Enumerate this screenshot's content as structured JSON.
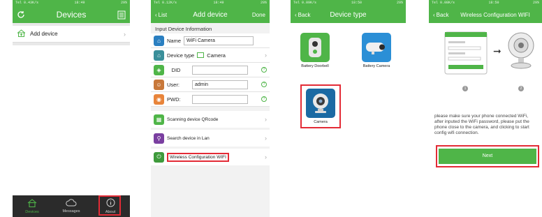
{
  "colors": {
    "accent": "#4fb548",
    "highlight": "#e32b36",
    "tabbar": "#2b2b2b"
  },
  "screen1": {
    "status_left": "Tel 0.43K/s",
    "status_time": "18:49",
    "status_right": "29%",
    "title": "Devices",
    "add_device": "Add device",
    "tabs": [
      {
        "label": "Devices",
        "icon": "home-icon"
      },
      {
        "label": "Messages",
        "icon": "cloud-icon"
      },
      {
        "label": "About",
        "icon": "info-icon"
      }
    ]
  },
  "screen2": {
    "status_left": "Tel 0.12K/s",
    "status_time": "18:49",
    "status_right": "29%",
    "back": "List",
    "title": "Add device",
    "done": "Done",
    "section": "Input Device Information",
    "name_label": "Name",
    "name_value": "WiFi Camera",
    "type_label": "Device type",
    "type_value": "Camera",
    "did_label": "DID",
    "user_label": "User:",
    "user_value": "admin",
    "pwd_label": "PWD:",
    "scan": "Scanning device QRcode",
    "search": "Search device in Lan",
    "wireless": "Wireless Configuration WIFI"
  },
  "screen3": {
    "status_left": "Tel 0.09K/s",
    "status_time": "18:50",
    "status_right": "29%",
    "back": "Back",
    "title": "Device type",
    "devices": [
      "Battery Doorbell",
      "Battery Camera",
      "Camera"
    ]
  },
  "screen4": {
    "status_left": "Tel 0.08K/s",
    "status_time": "18:50",
    "status_right": "29%",
    "back": "Back",
    "title": "Wireless Configuration WIFI",
    "step1": "1",
    "step2": "2",
    "instructions": "please make sure your phone connected WiFi, after inputed the WiFi password, please put the phone close to the camera, and clicking to start config wifi connection.",
    "next": "Next"
  }
}
